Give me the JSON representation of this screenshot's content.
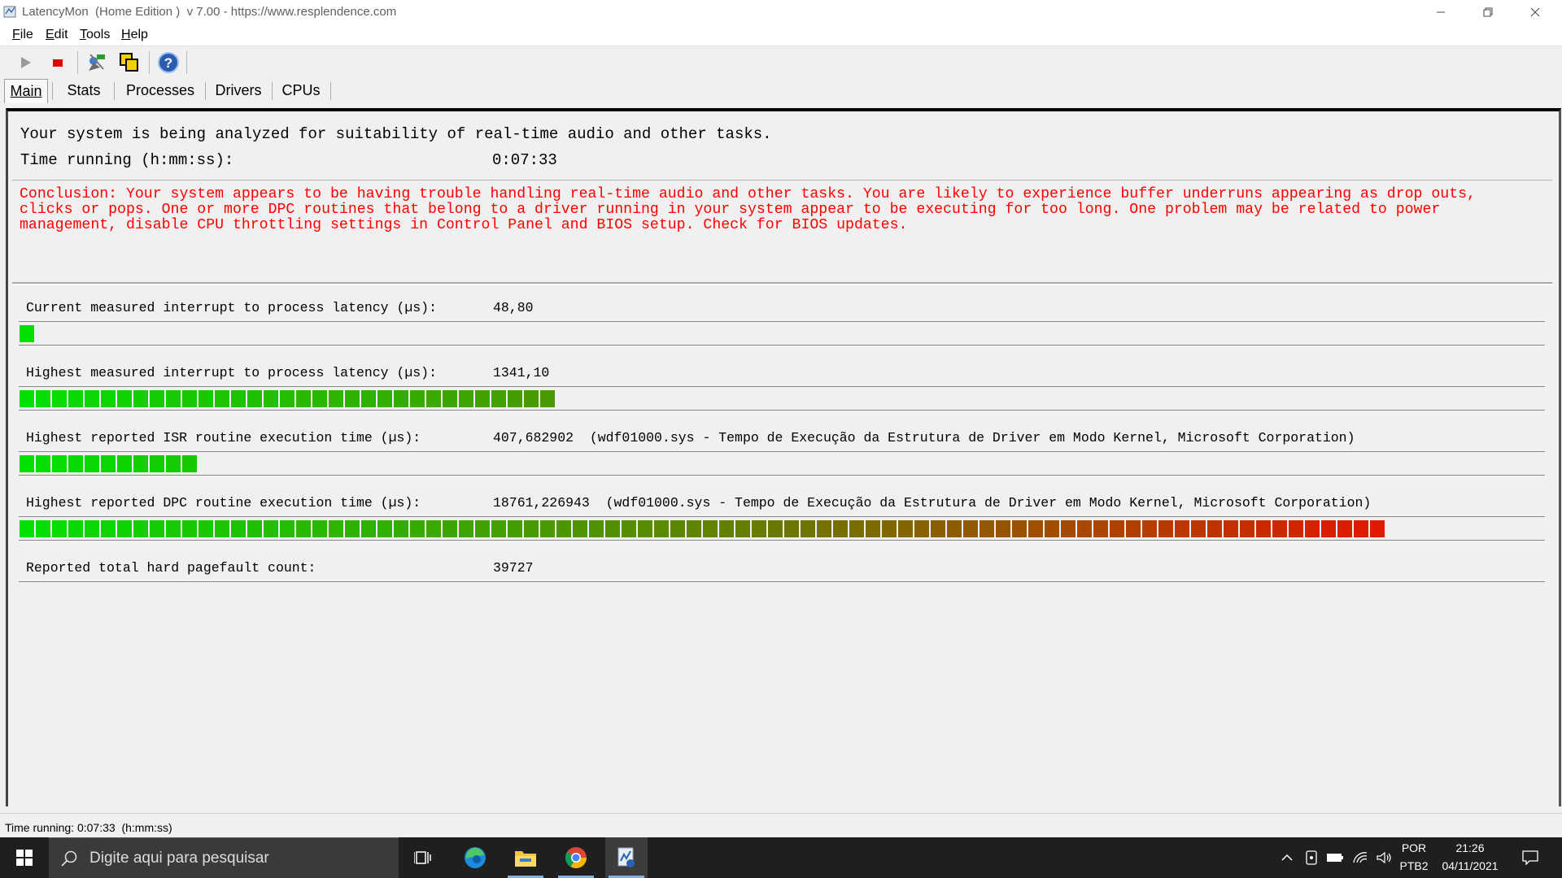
{
  "window": {
    "title": "LatencyMon  (Home Edition )  v 7.00 - https://www.resplendence.com"
  },
  "menu": [
    "File",
    "Edit",
    "Tools",
    "Help"
  ],
  "tabs": [
    "Main",
    "Stats",
    "Processes",
    "Drivers",
    "CPUs"
  ],
  "main": {
    "analyzing_text": "Your system is being analyzed for suitability of real-time audio and other tasks.",
    "time_running_label": "Time running (h:mm:ss):",
    "time_running_value": "0:07:33",
    "conclusion": "Conclusion: Your system appears to be having trouble handling real-time audio and other tasks. You are likely to experience buffer underruns appearing as drop outs,\nclicks or pops. One or more DPC routines that belong to a driver running in your system appear to be executing for too long. One problem may be related to power\nmanagement, disable CPU throttling settings in Control Panel and BIOS setup. Check for BIOS updates.",
    "metrics": [
      {
        "label": "Current measured interrupt to process latency (µs):",
        "value": "48,80",
        "bar_segments": 1
      },
      {
        "label": "Highest measured interrupt to process latency (µs):",
        "value": "1341,10",
        "bar_segments": 33
      },
      {
        "label": "Highest reported ISR routine execution time (µs):",
        "value": "407,682902  (wdf01000.sys - Tempo de Execução da Estrutura de Driver em Modo Kernel, Microsoft Corporation)",
        "bar_segments": 11
      },
      {
        "label": "Highest reported DPC routine execution time (µs):",
        "value": "18761,226943  (wdf01000.sys - Tempo de Execução da Estrutura de Driver em Modo Kernel, Microsoft Corporation)",
        "bar_segments": 84
      },
      {
        "label": "Reported total hard pagefault count:",
        "value": "39727"
      }
    ]
  },
  "statusbar": {
    "text": "Time running: 0:07:33  (h:mm:ss)"
  },
  "taskbar": {
    "search_placeholder": "Digite aqui para pesquisar",
    "language": "POR",
    "keyboard": "PTB2",
    "time": "21:26",
    "date": "04/11/2021"
  },
  "colors": {
    "conclusion": "#ff0000",
    "bar_start": "#00e000",
    "bar_mid": "#6a7a00",
    "bar_end": "#ff0000",
    "taskbar": "#1f1f1f"
  },
  "icons": {
    "toolbar": [
      "play-icon",
      "stop-icon",
      "wizard-icon",
      "copy-window-icon",
      "help-icon"
    ],
    "taskbar": [
      "windows-start-icon",
      "search-icon",
      "task-view-icon",
      "edge-icon",
      "file-explorer-icon",
      "chrome-icon",
      "latencymon-icon"
    ],
    "tray": [
      "chevron-up-icon",
      "tablet-icon",
      "battery-icon",
      "wifi-icon",
      "volume-icon",
      "notification-icon"
    ]
  }
}
